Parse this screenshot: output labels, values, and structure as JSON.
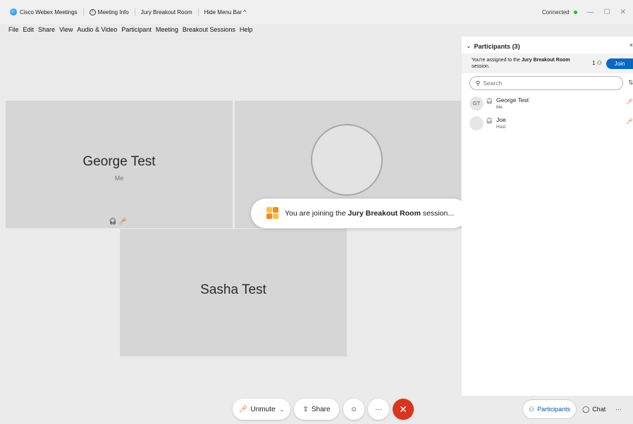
{
  "titlebar": {
    "app_name": "Cisco Webex Meetings",
    "meeting_info": "Meeting Info",
    "room": "Jury Breakout Room",
    "hide_menu": "Hide Menu Bar ^",
    "status": "Connected",
    "minimize": "—",
    "maximize": "☐",
    "close": "✕"
  },
  "menu": [
    "File",
    "Edit",
    "Share",
    "View",
    "Audio & Video",
    "Participant",
    "Meeting",
    "Breakout Sessions",
    "Help"
  ],
  "videos": {
    "george_name": "George Test",
    "george_sub": "Me",
    "sasha_name": "Sasha Test"
  },
  "toast": {
    "prefix": "You are joining the ",
    "room": "Jury Breakout Room",
    "suffix": " session..."
  },
  "controls": {
    "unmute": "Unmute",
    "share": "Share",
    "more": "···",
    "leave": "✕"
  },
  "panel": {
    "title": "Participants (3)",
    "assign_prefix": "You're assigned to the ",
    "assign_room": "Jury Breakout Room",
    "assign_suffix": "session.",
    "count": "1",
    "join": "Join",
    "search_placeholder": "Search",
    "participants": [
      {
        "initials": "GT",
        "name": "George Test",
        "role": "Me"
      },
      {
        "initials": "",
        "name": "Joe",
        "role": "Host"
      }
    ],
    "tabs": {
      "participants": "Participants",
      "chat": "Chat",
      "more": "···"
    }
  },
  "colors": {
    "accent": "#0a66c2",
    "leave": "#d5361f",
    "connected": "#2eb82e",
    "muted": "#e0502f"
  }
}
